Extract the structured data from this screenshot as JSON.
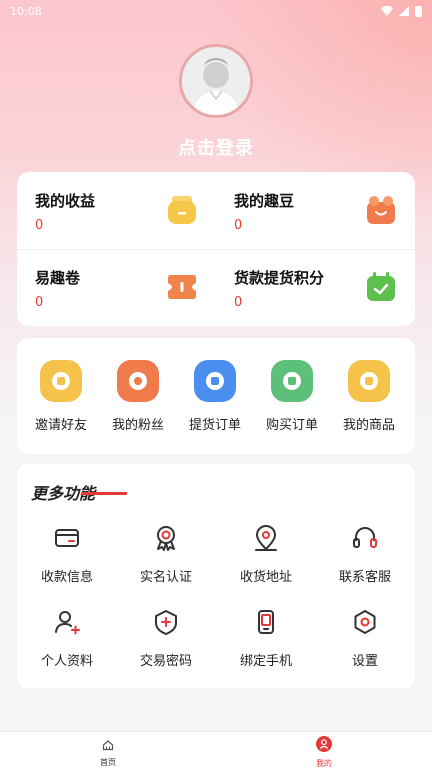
{
  "status_bar": {
    "time": "10:08"
  },
  "profile": {
    "login_text": "点击登录"
  },
  "earnings": [
    {
      "title": "我的收益",
      "value": "0",
      "icon": "wallet-icon",
      "color": "#f5c84a"
    },
    {
      "title": "我的趣豆",
      "value": "0",
      "icon": "gift-box-icon",
      "color": "#f07a4a"
    },
    {
      "title": "易趣卷",
      "value": "0",
      "icon": "coupon-icon",
      "color": "#f0844a"
    },
    {
      "title": "货款提货积分",
      "value": "0",
      "icon": "calendar-check-icon",
      "color": "#5cc04a"
    }
  ],
  "quick_actions": [
    {
      "label": "邀请好友",
      "icon": "envelope-icon",
      "color": "#f5c24a"
    },
    {
      "label": "我的粉丝",
      "icon": "fans-icon",
      "color": "#f07a4a"
    },
    {
      "label": "提货订单",
      "icon": "trophy-icon",
      "color": "#4a8ff0"
    },
    {
      "label": "购买订单",
      "icon": "coins-icon",
      "color": "#5cc07a"
    },
    {
      "label": "我的商品",
      "icon": "product-icon",
      "color": "#f5c24a"
    }
  ],
  "more": {
    "title": "更多功能",
    "items": [
      {
        "label": "收款信息",
        "icon": "card-icon"
      },
      {
        "label": "实名认证",
        "icon": "badge-icon"
      },
      {
        "label": "收货地址",
        "icon": "location-icon"
      },
      {
        "label": "联系客服",
        "icon": "headset-icon"
      },
      {
        "label": "个人资料",
        "icon": "user-icon"
      },
      {
        "label": "交易密码",
        "icon": "shield-icon"
      },
      {
        "label": "绑定手机",
        "icon": "phone-icon"
      },
      {
        "label": "设置",
        "icon": "settings-icon"
      }
    ]
  },
  "accent_color": "#e53935",
  "tabbar": [
    {
      "label": "首页",
      "icon": "home-icon"
    },
    {
      "label": "我的",
      "icon": "profile-icon"
    }
  ]
}
